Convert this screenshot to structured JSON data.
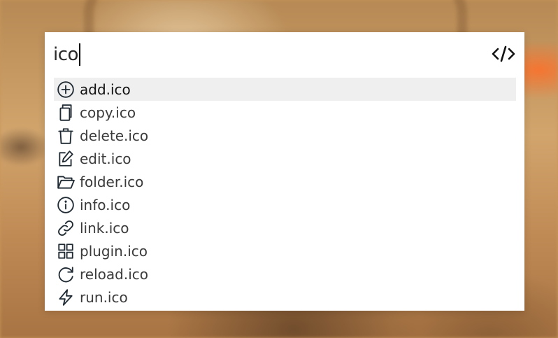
{
  "search": {
    "query": "ico"
  },
  "toolbar": {
    "code_icon": "code-icon"
  },
  "results": [
    {
      "label": "add.ico",
      "icon": "add-circle-icon",
      "selected": true
    },
    {
      "label": "copy.ico",
      "icon": "copy-icon",
      "selected": false
    },
    {
      "label": "delete.ico",
      "icon": "trash-icon",
      "selected": false
    },
    {
      "label": "edit.ico",
      "icon": "edit-icon",
      "selected": false
    },
    {
      "label": "folder.ico",
      "icon": "folder-open-icon",
      "selected": false
    },
    {
      "label": "info.ico",
      "icon": "info-icon",
      "selected": false
    },
    {
      "label": "link.ico",
      "icon": "link-icon",
      "selected": false
    },
    {
      "label": "plugin.ico",
      "icon": "grid-icon",
      "selected": false
    },
    {
      "label": "reload.ico",
      "icon": "reload-icon",
      "selected": false
    },
    {
      "label": "run.ico",
      "icon": "lightning-icon",
      "selected": false
    }
  ],
  "colors": {
    "selected_background": "#efefef",
    "icon_stroke": "#1f2a33"
  }
}
